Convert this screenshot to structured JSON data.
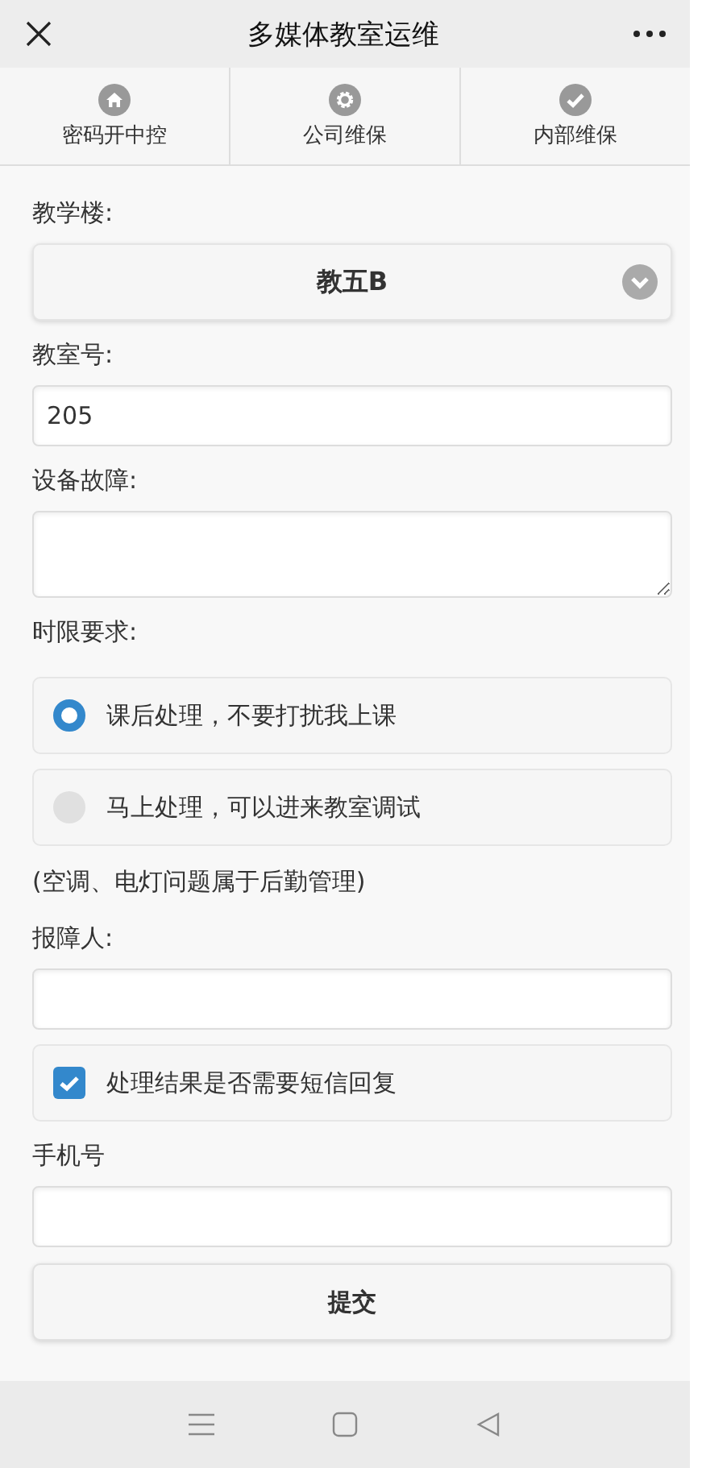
{
  "header": {
    "title": "多媒体教室运维"
  },
  "tabs": [
    {
      "label": "密码开中控",
      "kind": "home",
      "selected": false
    },
    {
      "label": "公司维保",
      "kind": "gear",
      "selected": false
    },
    {
      "label": "内部维保",
      "kind": "check",
      "selected": false
    }
  ],
  "form": [
    {
      "kind": "label",
      "text": "教学楼:"
    },
    {
      "kind": "select",
      "value": "教五B"
    },
    {
      "kind": "label",
      "text": "教室号:"
    },
    {
      "kind": "input",
      "value": "205"
    },
    {
      "kind": "label",
      "text": "设备故障:"
    },
    {
      "kind": "textarea"
    },
    {
      "kind": "label",
      "text": "时限要求:"
    },
    {
      "kind": "radio",
      "label": "课后处理，不要打扰我上课",
      "selected": true
    },
    {
      "kind": "radio",
      "label": "马上处理，可以进来教室调试",
      "selected": false
    },
    {
      "kind": "note",
      "text": "(空调、电灯问题属于后勤管理)"
    },
    {
      "kind": "label",
      "text": "报障人:"
    },
    {
      "kind": "input"
    },
    {
      "kind": "checkbox",
      "label": "处理结果是否需要短信回复",
      "checked": true
    },
    {
      "kind": "label",
      "text": "手机号"
    },
    {
      "kind": "input"
    },
    {
      "kind": "button",
      "label": "提交"
    }
  ]
}
